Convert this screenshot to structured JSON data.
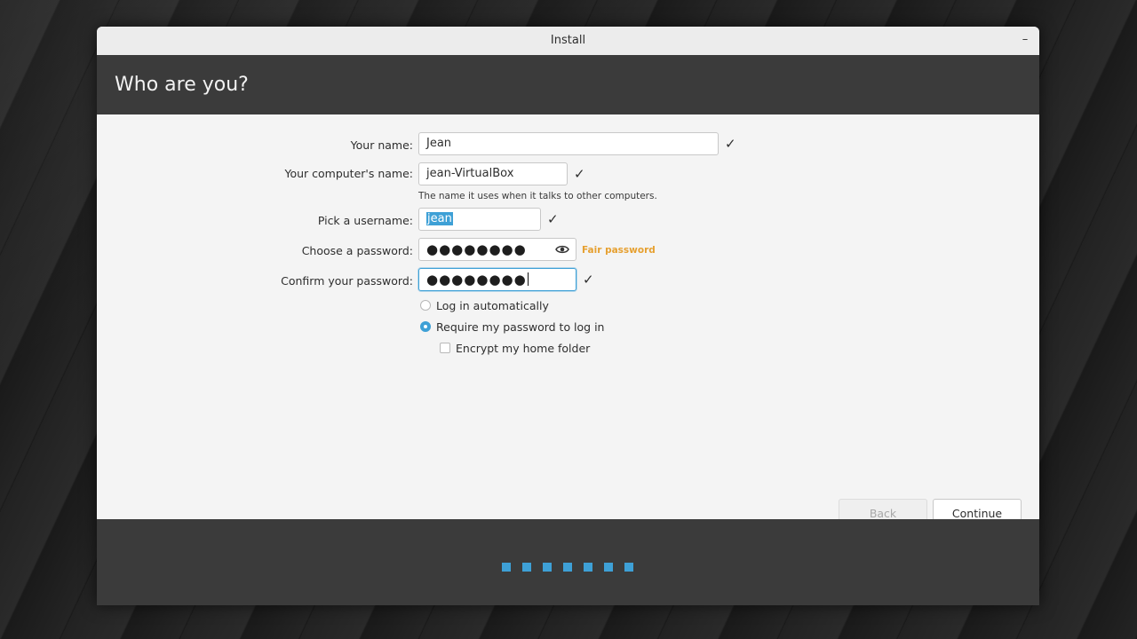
{
  "window": {
    "title": "Install",
    "minimize_label": "–"
  },
  "header": {
    "title": "Who are you?"
  },
  "form": {
    "name": {
      "label": "Your name:",
      "value": "Jean"
    },
    "computer_name": {
      "label": "Your computer's name:",
      "value": "jean-VirtualBox",
      "hint": "The name it uses when it talks to other computers."
    },
    "username": {
      "label": "Pick a username:",
      "value": "jean"
    },
    "password": {
      "label": "Choose a password:",
      "masked_value": "●●●●●●●●",
      "strength": "Fair password"
    },
    "confirm_password": {
      "label": "Confirm your password:",
      "masked_value": "●●●●●●●●"
    },
    "check_mark": "✓",
    "login_options": {
      "auto_login_label": "Log in automatically",
      "auto_login_selected": false,
      "require_password_label": "Require my password to log in",
      "require_password_selected": true,
      "encrypt_label": "Encrypt my home folder",
      "encrypt_checked": false
    }
  },
  "buttons": {
    "back_label": "Back",
    "back_enabled": false,
    "continue_label": "Continue"
  },
  "progress": {
    "total_steps": 7
  },
  "colors": {
    "accent": "#3ea0d6",
    "warning": "#e6a030",
    "header_bg": "#3b3b3b"
  }
}
